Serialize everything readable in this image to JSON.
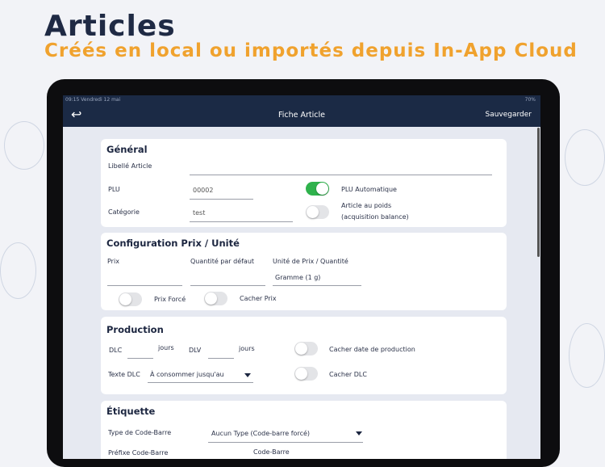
{
  "header": {
    "title": "Articles",
    "subtitle": "Créés en local ou importés depuis In-App Cloud"
  },
  "status_bar": {
    "time": "09:15  Vendredi 12 mai",
    "battery": "70%"
  },
  "nav": {
    "title": "Fiche Article",
    "save": "Sauvegarder",
    "back_icon": "reply-arrow-icon"
  },
  "general": {
    "title": "Général",
    "libelle_label": "Libellé Article",
    "libelle_value": "",
    "plu_label": "PLU",
    "plu_value": "00002",
    "plu_auto_label": "PLU Automatique",
    "plu_auto_on": true,
    "categorie_label": "Catégorie",
    "categorie_value": "test",
    "poids_label_1": "Article au poids",
    "poids_label_2": "(acquisition balance)",
    "poids_on": false
  },
  "prix": {
    "title": "Configuration Prix / Unité",
    "prix_label": "Prix",
    "quantite_label": "Quantité par défaut",
    "unite_label": "Unité de Prix / Quantité",
    "unite_value": "Gramme (1 g)",
    "prix_force_label": "Prix Forcé",
    "prix_force_on": false,
    "cacher_prix_label": "Cacher Prix",
    "cacher_prix_on": false
  },
  "production": {
    "title": "Production",
    "dlc_label": "DLC",
    "dlc_unit": "jours",
    "dlv_label": "DLV",
    "dlv_unit": "jours",
    "cacher_date_label": "Cacher date de production",
    "cacher_date_on": false,
    "texte_dlc_label": "Texte DLC",
    "texte_dlc_value": "À consommer jusqu'au",
    "cacher_dlc_label": "Cacher DLC",
    "cacher_dlc_on": false
  },
  "etiquette": {
    "title": "Étiquette",
    "type_label": "Type de Code-Barre",
    "type_value": "Aucun Type (Code-barre forcé)",
    "prefixe_label": "Préfixe Code-Barre",
    "code_label": "Code-Barre"
  }
}
